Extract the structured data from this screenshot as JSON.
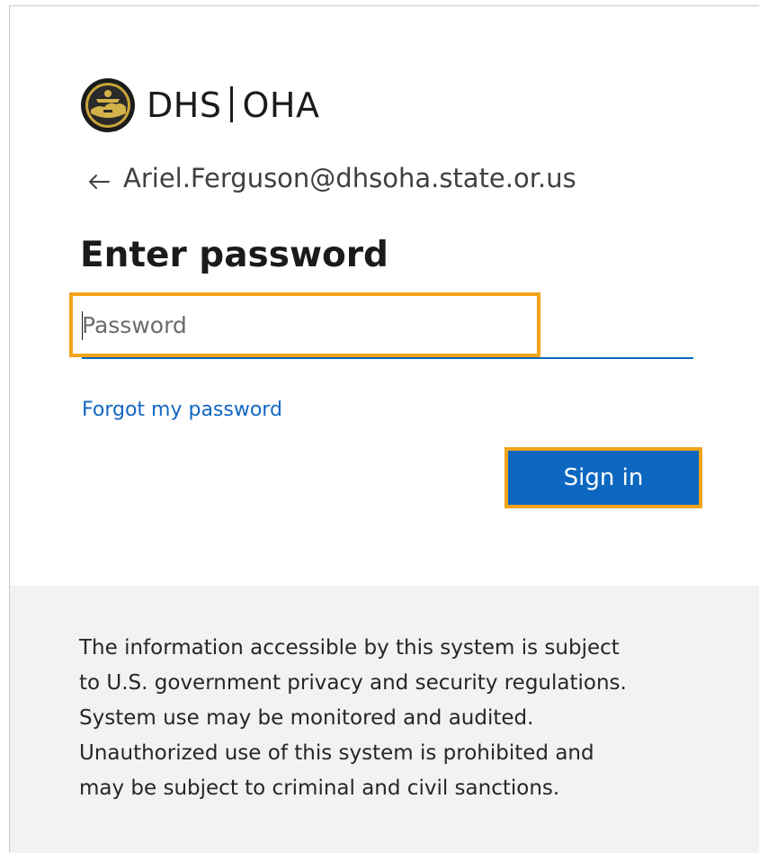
{
  "brand": {
    "left": "DHS",
    "right": "OHA",
    "logo_icon": "oregon-state-seal-icon"
  },
  "identity": {
    "back_icon": "back-arrow-icon",
    "email": "Ariel.Ferguson@dhsoha.state.or.us"
  },
  "form": {
    "title": "Enter password",
    "password": {
      "value": "",
      "placeholder": "Password"
    },
    "forgot_link": "Forgot my password",
    "signin_label": "Sign in"
  },
  "notice": {
    "text": "The information accessible by this system is subject\nto U.S. government privacy and security regulations.\nSystem use may be monitored and audited.\nUnauthorized use of this system is prohibited and\nmay be subject to criminal and civil sanctions."
  },
  "colors": {
    "accent": "#0b67c0",
    "link": "#1266c4",
    "highlight": "#f0a418",
    "notice_bg": "#f2f2f2"
  }
}
